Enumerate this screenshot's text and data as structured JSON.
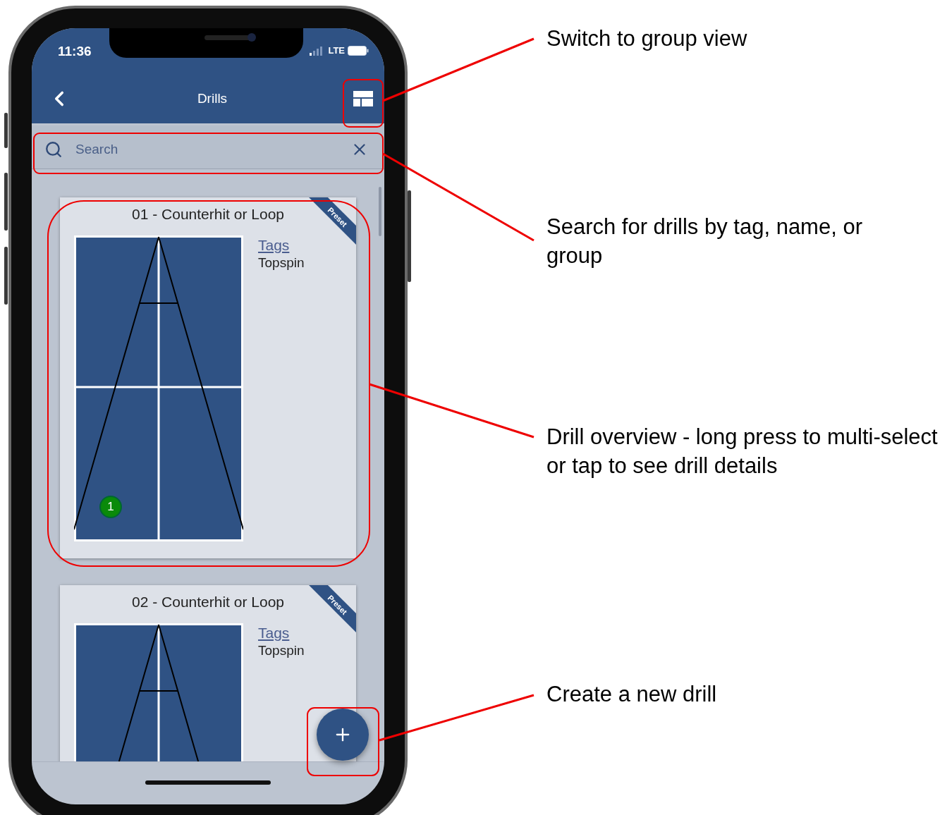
{
  "status_bar": {
    "time": "11:36",
    "network": "LTE"
  },
  "nav_bar": {
    "title": "Drills"
  },
  "search": {
    "placeholder": "Search"
  },
  "drills": [
    {
      "title": "01 - Counterhit or Loop",
      "badge": "Preset",
      "tags_label": "Tags",
      "tags": "Topspin",
      "markers": [
        {
          "label": "1",
          "color": "#0a8a0a"
        }
      ]
    },
    {
      "title": "02 - Counterhit or Loop",
      "badge": "Preset",
      "tags_label": "Tags",
      "tags": "Topspin"
    }
  ],
  "annotations": [
    {
      "text": "Switch to group view"
    },
    {
      "text": "Search for drills by tag, name, or group"
    },
    {
      "text": "Drill overview - long press to multi-select or tap to see drill details"
    },
    {
      "text": "Create a new drill"
    }
  ]
}
